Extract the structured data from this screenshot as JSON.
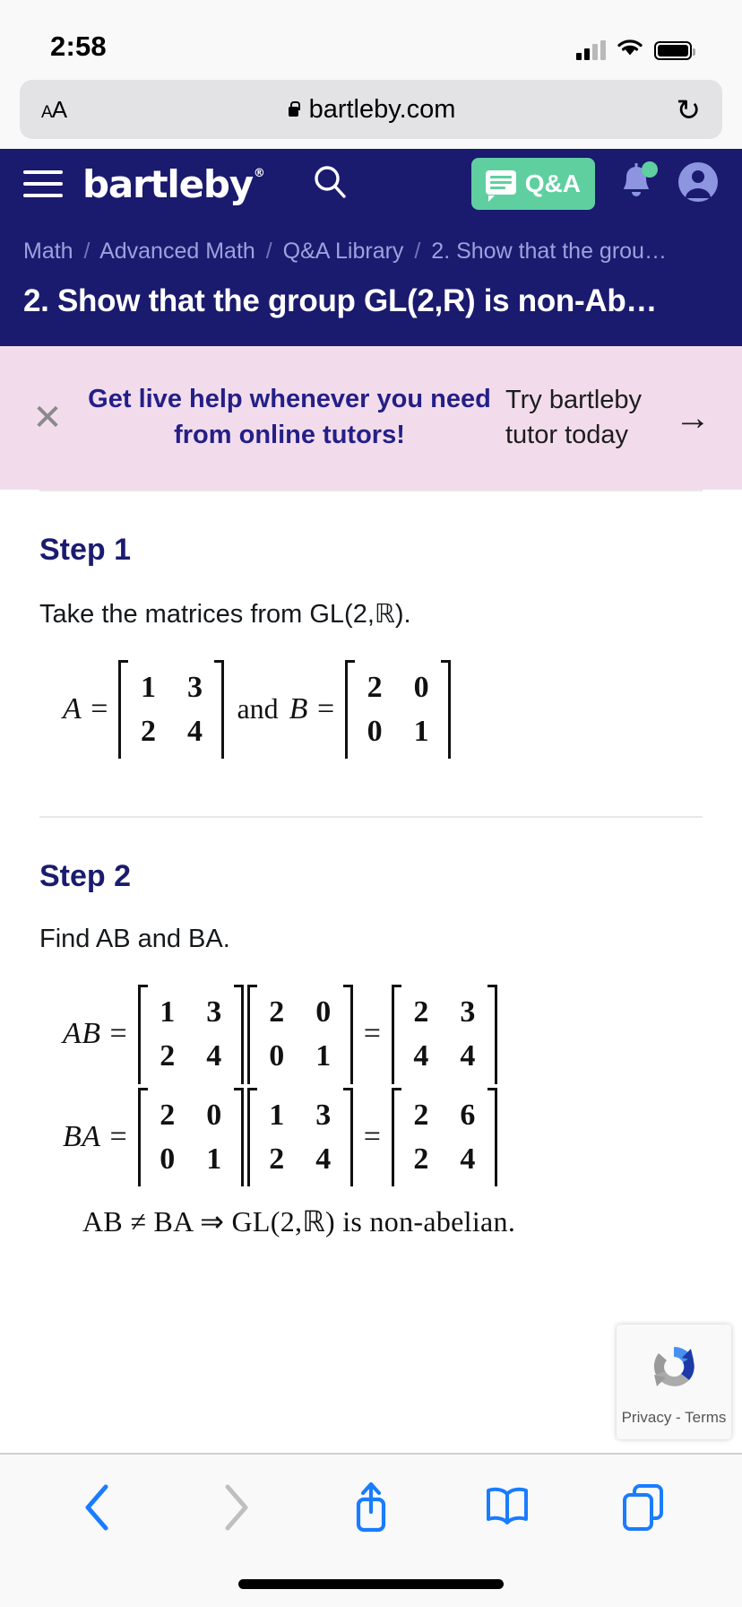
{
  "status_bar": {
    "time": "2:58",
    "signal_icon": "cellular-signal-icon",
    "wifi_icon": "wifi-icon",
    "battery_icon": "battery-icon"
  },
  "browser": {
    "text_size_label": "AA",
    "lock_icon": "lock-icon",
    "url": "bartleby.com",
    "reload_icon": "reload-icon",
    "toolbar": {
      "back_icon": "chevron-left-icon",
      "forward_icon": "chevron-right-icon",
      "share_icon": "share-icon",
      "bookmarks_icon": "book-icon",
      "tabs_icon": "tabs-icon"
    }
  },
  "site_header": {
    "menu_icon": "hamburger-menu-icon",
    "logo_text": "bartleby",
    "logo_mark": "®",
    "search_icon": "search-icon",
    "qa_button": {
      "label": "Q&A",
      "icon": "chat-bubble-icon",
      "color": "#5fcfa0"
    },
    "bell_icon": "notification-bell-icon",
    "account_icon": "account-avatar-icon",
    "background_color": "#1a1a6e",
    "breadcrumb": [
      "Math",
      "Advanced Math",
      "Q&A Library",
      "2. Show that the grou…"
    ],
    "breadcrumb_separator": "/",
    "page_title": "2. Show that the group GL(2,R) is non-Ab…"
  },
  "promo_banner": {
    "close_icon": "close-x-icon",
    "message": "Get live help whenever you need from online tutors!",
    "cta_text": "Try bartleby tutor today",
    "arrow_icon": "arrow-right-icon",
    "background_color": "#f2dcec",
    "text_color": "#241f87"
  },
  "answer": {
    "steps": [
      {
        "heading": "Step 1",
        "text": "Take the matrices from GL(2,ℝ).",
        "equations": [
          {
            "lhs": "A",
            "parts": [
              {
                "type": "matrix",
                "rows": [
                  [
                    "1",
                    "3"
                  ],
                  [
                    "2",
                    "4"
                  ]
                ]
              },
              {
                "type": "word",
                "text": "and"
              },
              {
                "type": "var",
                "text": "B"
              },
              {
                "type": "op",
                "text": "="
              },
              {
                "type": "matrix",
                "rows": [
                  [
                    "2",
                    "0"
                  ],
                  [
                    "0",
                    "1"
                  ]
                ]
              }
            ]
          }
        ]
      },
      {
        "heading": "Step 2",
        "text": "Find AB and BA.",
        "equations": [
          {
            "lhs": "AB",
            "parts": [
              {
                "type": "matrix",
                "rows": [
                  [
                    "1",
                    "3"
                  ],
                  [
                    "2",
                    "4"
                  ]
                ]
              },
              {
                "type": "matrix",
                "rows": [
                  [
                    "2",
                    "0"
                  ],
                  [
                    "0",
                    "1"
                  ]
                ]
              },
              {
                "type": "op",
                "text": "="
              },
              {
                "type": "matrix",
                "rows": [
                  [
                    "2",
                    "3"
                  ],
                  [
                    "4",
                    "4"
                  ]
                ]
              }
            ]
          },
          {
            "lhs": "BA",
            "parts": [
              {
                "type": "matrix",
                "rows": [
                  [
                    "2",
                    "0"
                  ],
                  [
                    "0",
                    "1"
                  ]
                ]
              },
              {
                "type": "matrix",
                "rows": [
                  [
                    "1",
                    "3"
                  ],
                  [
                    "2",
                    "4"
                  ]
                ]
              },
              {
                "type": "op",
                "text": "="
              },
              {
                "type": "matrix",
                "rows": [
                  [
                    "2",
                    "6"
                  ],
                  [
                    "2",
                    "4"
                  ]
                ]
              }
            ]
          }
        ],
        "conclusion": "AB ≠ BA ⇒ GL(2,ℝ) is non-abelian."
      }
    ]
  },
  "recaptcha": {
    "icon": "recaptcha-logo-icon",
    "label": "Privacy - Terms"
  }
}
